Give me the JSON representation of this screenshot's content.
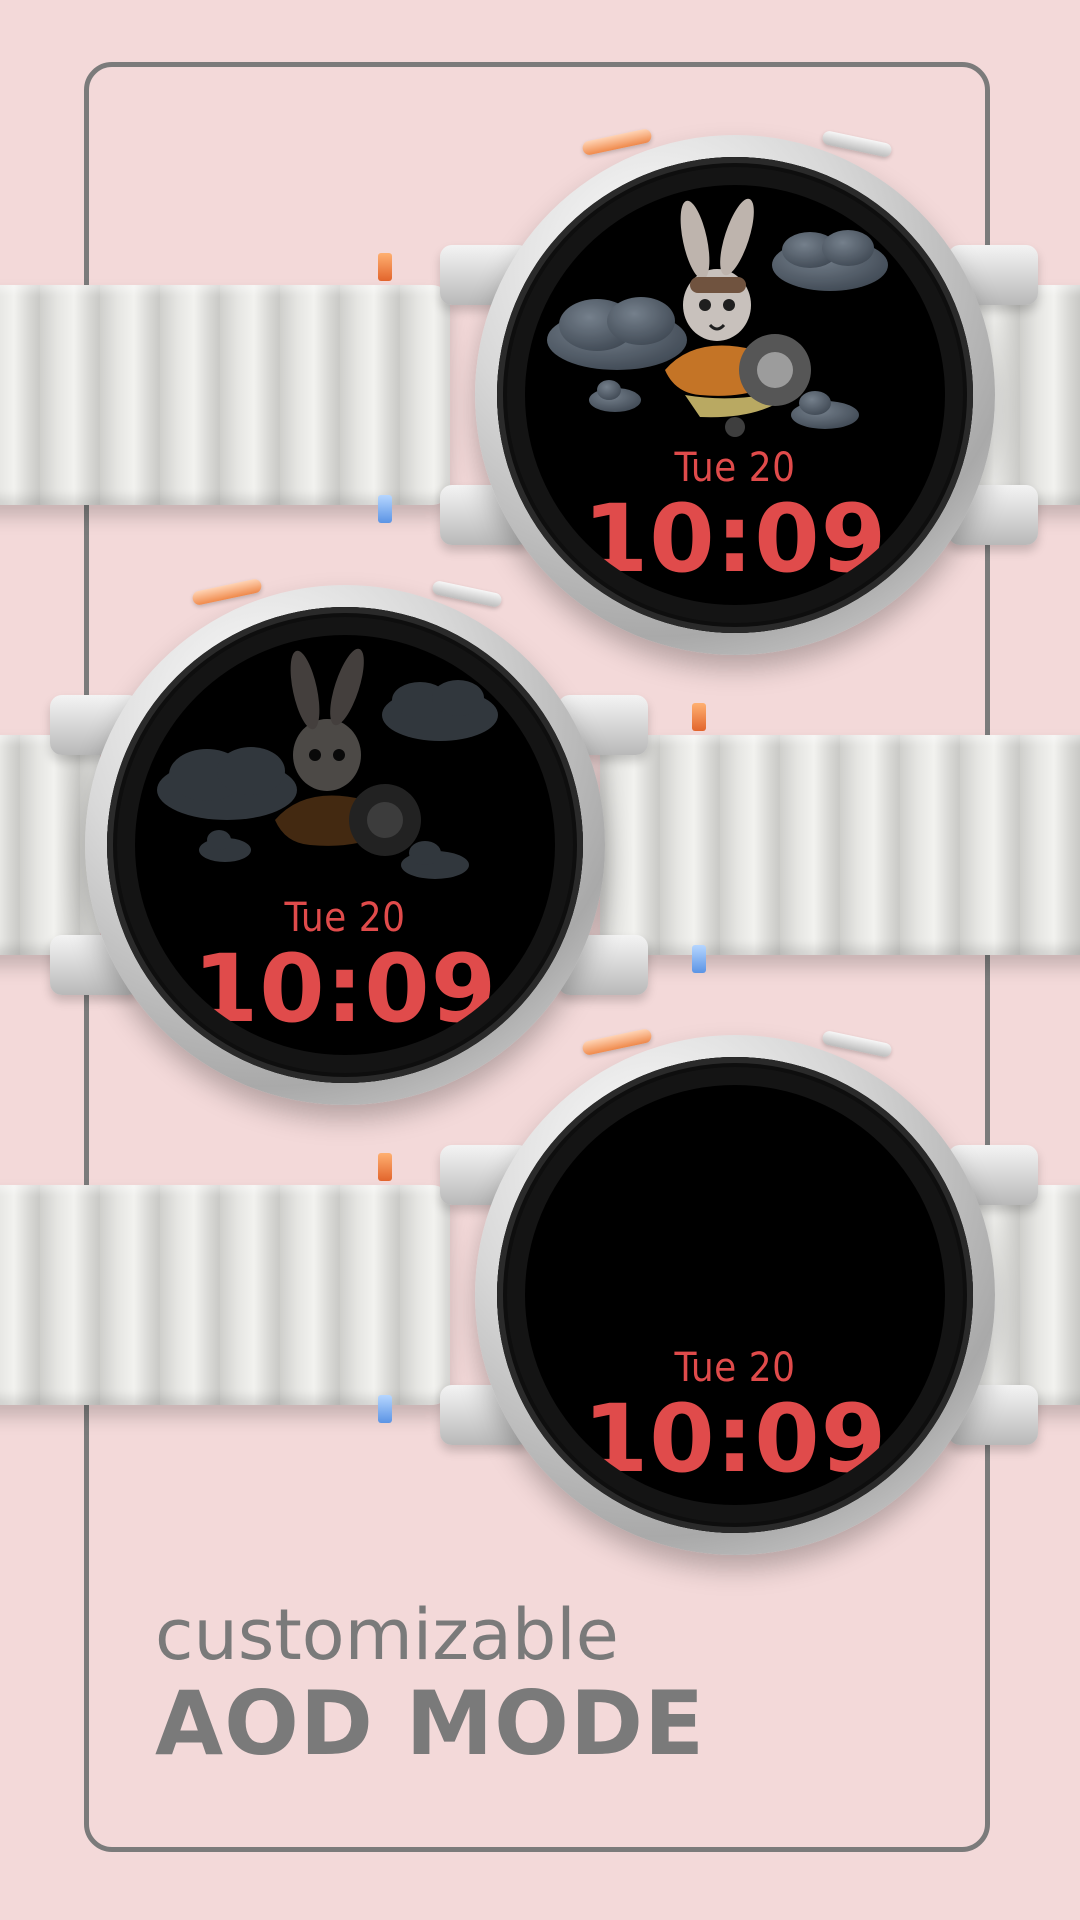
{
  "watch_faces": [
    {
      "date": "Tue 20",
      "time": "10:09",
      "show_art": true
    },
    {
      "date": "Tue 20",
      "time": "10:09",
      "show_art": true
    },
    {
      "date": "Tue 20",
      "time": "10:09",
      "show_art": false
    }
  ],
  "caption": {
    "subtitle": "customizable",
    "title": "AOD MODE"
  },
  "colors": {
    "background": "#f3d9d9",
    "frame": "#7b7b7b",
    "digits": "#e04b4b",
    "text": "#7a7a7a"
  }
}
